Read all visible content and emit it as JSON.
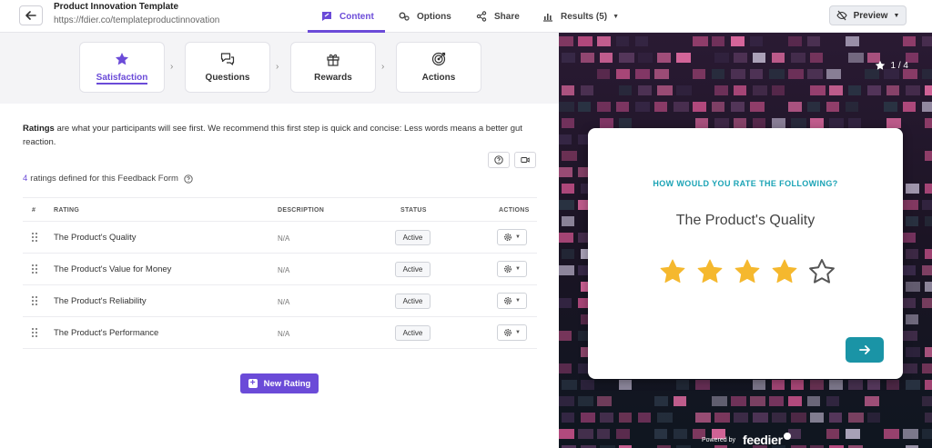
{
  "header": {
    "title": "Product Innovation Template",
    "url": "https://fdier.co/templateproductinnovation",
    "nav": [
      {
        "label": "Content",
        "icon": "edit-chat-icon"
      },
      {
        "label": "Options",
        "icon": "gears-icon"
      },
      {
        "label": "Share",
        "icon": "share-icon"
      },
      {
        "label": "Results (5)",
        "icon": "chart-icon"
      }
    ],
    "preview_label": "Preview"
  },
  "steps": [
    {
      "label": "Satisfaction",
      "icon": "star-icon"
    },
    {
      "label": "Questions",
      "icon": "chat-bubbles-icon"
    },
    {
      "label": "Rewards",
      "icon": "gift-icon"
    },
    {
      "label": "Actions",
      "icon": "target-icon"
    }
  ],
  "intro": {
    "bold": "Ratings",
    "text": " are what your participants will see first. We recommend this first step is quick and concise: Less words means a better gut reaction."
  },
  "ratings_count": {
    "number": "4",
    "text": "ratings defined for this Feedback Form"
  },
  "table": {
    "columns": [
      "#",
      "RATING",
      "DESCRIPTION",
      "STATUS",
      "ACTIONS"
    ],
    "rows": [
      {
        "name": "The Product's Quality",
        "description": "N/A",
        "status": "Active"
      },
      {
        "name": "The Product's Value for Money",
        "description": "N/A",
        "status": "Active"
      },
      {
        "name": "The Product's Reliability",
        "description": "N/A",
        "status": "Active"
      },
      {
        "name": "The Product's Performance",
        "description": "N/A",
        "status": "Active"
      }
    ]
  },
  "new_rating_label": "New Rating",
  "preview": {
    "counter": "1 / 4",
    "question_title": "HOW WOULD YOU RATE THE FOLLOWING?",
    "item": "The Product's Quality",
    "rating": 4,
    "max_rating": 5,
    "powered_by": "Powered by",
    "brand": "feedier",
    "colors": {
      "accent": "#6b4bd8",
      "teal": "#1a94a6",
      "star": "#f5b82e"
    }
  }
}
